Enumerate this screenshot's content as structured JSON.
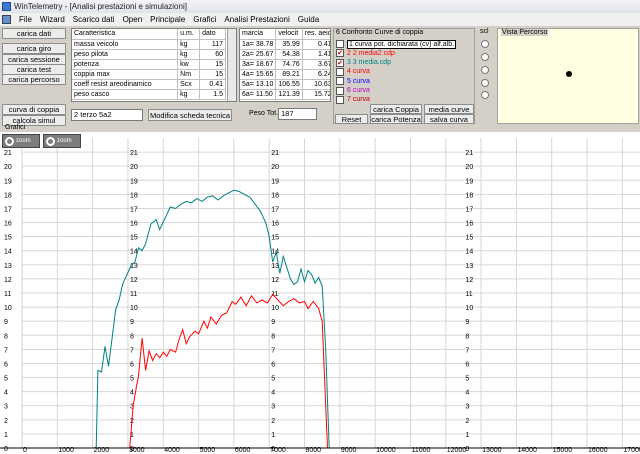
{
  "window": {
    "title": "WinTelemetry - [Analisi prestazioni e simulazioni]"
  },
  "menu": [
    "File",
    "Wizard",
    "Scarico dati",
    "Open",
    "Principale",
    "Grafici",
    "Analisi Prestazioni",
    "Guida"
  ],
  "left_buttons": {
    "carica_dati": "carica dati",
    "carica_giro": "carica giro",
    "carica_sessione": "carica sessione",
    "carica_test": "carica test",
    "carica_percorso": "carica percorso",
    "curva_di_coppia": "curva di coppia",
    "calcola_simul": "calcola simul"
  },
  "specs": {
    "headers": [
      "Caratteristica",
      "u.m.",
      "dato"
    ],
    "rows": [
      {
        "name": "massa veicolo",
        "unit": "kg",
        "value": "117"
      },
      {
        "name": "peso pilota",
        "unit": "kg",
        "value": "60"
      },
      {
        "name": "potenza",
        "unit": "kw",
        "value": "15"
      },
      {
        "name": "coppia max",
        "unit": "Nm",
        "value": "15"
      },
      {
        "name": "coeff resist areodinamico",
        "unit": "Scx",
        "value": "0.41"
      },
      {
        "name": "peso casco",
        "unit": "kg",
        "value": "1.5"
      }
    ]
  },
  "gears": {
    "headers": [
      "marcia",
      "velocit",
      "res. aeio"
    ],
    "rows": [
      {
        "gear": "1a= 38.78",
        "speed": "35.99",
        "res": "0.41"
      },
      {
        "gear": "2a= 25.67",
        "speed": "54.38",
        "res": "1.41"
      },
      {
        "gear": "3a= 18.67",
        "speed": "74.76",
        "res": "3.67"
      },
      {
        "gear": "4a= 15.65",
        "speed": "89.21",
        "res": "6.24"
      },
      {
        "gear": "5a= 13.10",
        "speed": "106.55",
        "res": "10.63"
      },
      {
        "gear": "6a= 11.50",
        "speed": "121.39",
        "res": "15.72"
      }
    ]
  },
  "curve_panel": {
    "title": "6 Confronto Curve di coppia",
    "items": [
      {
        "label": "1 curva pot. dichiarata (cv) alf.alb.",
        "checked": false,
        "color": "#000000"
      },
      {
        "label": "2 2 media2.cdp",
        "checked": true,
        "color": "#ff0000"
      },
      {
        "label": "3 3 media.cdp",
        "checked": true,
        "color": "#008080"
      },
      {
        "label": "4 curva",
        "checked": false,
        "color": "#ff0000"
      },
      {
        "label": "5 curva",
        "checked": false,
        "color": "#0000ff"
      },
      {
        "label": "6 curva",
        "checked": false,
        "color": "#c000c0"
      },
      {
        "label": "7 curva",
        "checked": false,
        "color": "#c00000"
      }
    ],
    "check_mark": "✔",
    "carica_coppia": "carica Coppia",
    "media_curve": "media curve",
    "reset": "Reset",
    "carica_potenza": "carica Potenza",
    "salva_curva": "salva curva"
  },
  "scl_label": "scl",
  "vista_percorso": "Vista Percorso",
  "gear_ratio_input": "2 terzo 5a2",
  "modifica_button": "Modifica scheda tecnica",
  "peso_tot_label": "Peso Tot.",
  "peso_tot_value": "187",
  "grafici_label": "Grafici",
  "zoom_label": "zoom",
  "chart_data": {
    "type": "line",
    "xlim": [
      0,
      17500
    ],
    "ylim": [
      0,
      22
    ],
    "x_ticks": [
      0,
      1000,
      2000,
      3000,
      4000,
      5000,
      6000,
      7000,
      8000,
      9000,
      10000,
      11000,
      12000,
      13000,
      14000,
      15000,
      16000,
      17000
    ],
    "y_ticks": [
      0,
      1,
      2,
      3,
      4,
      5,
      6,
      7,
      8,
      9,
      10,
      11,
      12,
      13,
      14,
      15,
      16,
      17,
      18,
      19,
      20,
      21
    ],
    "y_tick_columns_x": [
      0,
      3000,
      7000,
      12500
    ],
    "series": [
      {
        "name": "3 3 media.cdp",
        "color": "#008080",
        "points": [
          [
            2100,
            0
          ],
          [
            2150,
            5.5
          ],
          [
            2250,
            5.4
          ],
          [
            2350,
            7.2
          ],
          [
            2450,
            5.8
          ],
          [
            2550,
            7.8
          ],
          [
            2650,
            9.8
          ],
          [
            2750,
            10.5
          ],
          [
            2850,
            11.6
          ],
          [
            2950,
            12.2
          ],
          [
            3100,
            13.0
          ],
          [
            3200,
            13.2
          ],
          [
            3300,
            14.2
          ],
          [
            3400,
            14.0
          ],
          [
            3500,
            14.5
          ],
          [
            3650,
            15.9
          ],
          [
            3800,
            16.2
          ],
          [
            3900,
            15.5
          ],
          [
            4050,
            16.3
          ],
          [
            4200,
            17.1
          ],
          [
            4350,
            17.0
          ],
          [
            4500,
            17.3
          ],
          [
            4650,
            17.5
          ],
          [
            4800,
            17.4
          ],
          [
            4950,
            17.7
          ],
          [
            5100,
            17.5
          ],
          [
            5250,
            17.8
          ],
          [
            5400,
            17.9
          ],
          [
            5550,
            17.6
          ],
          [
            5700,
            17.9
          ],
          [
            5850,
            18.1
          ],
          [
            6000,
            18.3
          ],
          [
            6150,
            18.2
          ],
          [
            6300,
            18.0
          ],
          [
            6450,
            17.8
          ],
          [
            6600,
            17.3
          ],
          [
            6750,
            16.8
          ],
          [
            6900,
            16.0
          ],
          [
            7000,
            15.0
          ],
          [
            7100,
            13.2
          ],
          [
            7200,
            13.9
          ],
          [
            7300,
            12.4
          ],
          [
            7400,
            13.6
          ],
          [
            7500,
            12.8
          ],
          [
            7600,
            12.0
          ],
          [
            7700,
            11.6
          ],
          [
            7800,
            11.8
          ],
          [
            7900,
            12.7
          ],
          [
            8000,
            11.8
          ],
          [
            8100,
            12.6
          ],
          [
            8200,
            12.3
          ],
          [
            8300,
            11.7
          ],
          [
            8400,
            12.1
          ],
          [
            8500,
            11.5
          ],
          [
            8600,
            7.0
          ],
          [
            8700,
            0
          ]
        ]
      },
      {
        "name": "2 2 media2.cdp",
        "color": "#ff0000",
        "points": [
          [
            3050,
            0
          ],
          [
            3150,
            3.0
          ],
          [
            3250,
            4.5
          ],
          [
            3300,
            5.1
          ],
          [
            3400,
            7.8
          ],
          [
            3500,
            5.5
          ],
          [
            3600,
            6.9
          ],
          [
            3700,
            6.2
          ],
          [
            3800,
            6.7
          ],
          [
            3900,
            6.4
          ],
          [
            4000,
            6.8
          ],
          [
            4100,
            6.5
          ],
          [
            4200,
            7.0
          ],
          [
            4350,
            6.8
          ],
          [
            4450,
            7.7
          ],
          [
            4550,
            8.4
          ],
          [
            4650,
            7.4
          ],
          [
            4750,
            7.9
          ],
          [
            4900,
            8.3
          ],
          [
            5000,
            8.1
          ],
          [
            5150,
            9.0
          ],
          [
            5250,
            8.5
          ],
          [
            5350,
            9.3
          ],
          [
            5500,
            8.8
          ],
          [
            5650,
            9.4
          ],
          [
            5800,
            9.6
          ],
          [
            5950,
            10.4
          ],
          [
            6050,
            10.2
          ],
          [
            6200,
            10.7
          ],
          [
            6350,
            10.1
          ],
          [
            6500,
            10.8
          ],
          [
            6650,
            10.3
          ],
          [
            6800,
            10.5
          ],
          [
            6950,
            10.3
          ],
          [
            7100,
            10.9
          ],
          [
            7250,
            10.5
          ],
          [
            7400,
            10.1
          ],
          [
            7550,
            10.4
          ],
          [
            7700,
            10.6
          ],
          [
            7850,
            10.3
          ],
          [
            8000,
            10.4
          ],
          [
            8100,
            9.9
          ],
          [
            8250,
            10.4
          ],
          [
            8400,
            9.9
          ],
          [
            8500,
            9.0
          ],
          [
            8600,
            3.0
          ],
          [
            8650,
            0
          ]
        ]
      }
    ]
  }
}
